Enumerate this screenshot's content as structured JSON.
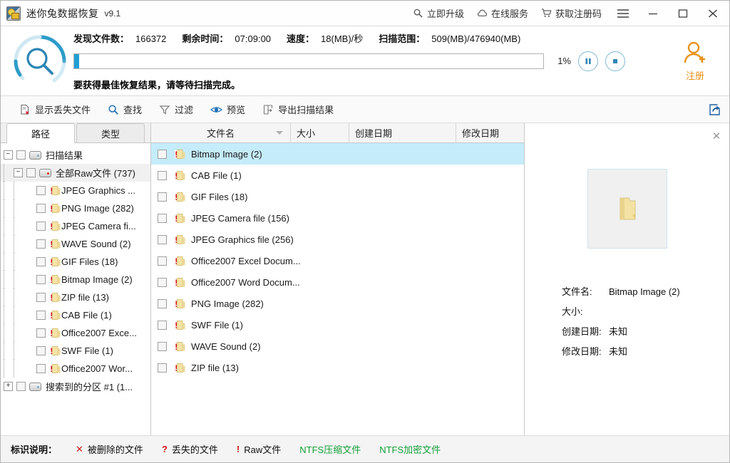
{
  "titlebar": {
    "app_icon": "app-logo-icon",
    "title": "迷你兔数据恢复",
    "version": "v9.1",
    "links": [
      {
        "icon": "magnifier-icon",
        "label": "立即升级"
      },
      {
        "icon": "cloud-icon",
        "label": "在线服务"
      },
      {
        "icon": "cart-icon",
        "label": "获取注册码"
      }
    ],
    "menu_icon": "hamburger-icon",
    "minimize_icon": "minimize-icon",
    "maximize_icon": "maximize-icon",
    "close_icon": "close-icon"
  },
  "scan": {
    "logo_icon": "scan-magnifier-icon",
    "stats": [
      {
        "label": "发现文件数：",
        "value": "166372"
      },
      {
        "label": "剩余时间：",
        "value": "07:09:00"
      },
      {
        "label": "速度：",
        "value": "18(MB)/秒"
      },
      {
        "label": "扫描范围：",
        "value": "509(MB)/476940(MB)"
      }
    ],
    "progress_percent": 1,
    "progress_label": "1%",
    "pause_icon": "pause-icon",
    "stop_icon": "stop-icon",
    "hint": "要获得最佳恢复结果，请等待扫描完成。",
    "register": {
      "icon": "user-add-icon",
      "label": "注册",
      "color": "#e8921b"
    }
  },
  "toolbar": {
    "buttons": [
      {
        "icon": "show-lost-files-icon",
        "label": "显示丢失文件"
      },
      {
        "icon": "search-icon",
        "label": "查找"
      },
      {
        "icon": "filter-icon",
        "label": "过滤"
      },
      {
        "icon": "preview-eye-icon",
        "label": "预览"
      },
      {
        "icon": "export-results-icon",
        "label": "导出扫描结果"
      }
    ],
    "share_icon": "share-export-icon"
  },
  "left_panel": {
    "tabs": [
      {
        "label": "路径",
        "active": true
      },
      {
        "label": "类型",
        "active": false
      }
    ],
    "tree": [
      {
        "label": "扫描结果",
        "depth": 0,
        "icon": "drive-icon",
        "expander": "minus",
        "selected": false
      },
      {
        "label": "全部Raw文件 (737)",
        "depth": 1,
        "icon": "drive-red-icon",
        "expander": "minus",
        "selected": true
      },
      {
        "label": "JPEG Graphics ...",
        "depth": 2,
        "icon": "raw-folder-icon",
        "expander": "none",
        "selected": false
      },
      {
        "label": "PNG Image (282)",
        "depth": 2,
        "icon": "raw-folder-icon",
        "expander": "none",
        "selected": false
      },
      {
        "label": "JPEG Camera fi...",
        "depth": 2,
        "icon": "raw-folder-icon",
        "expander": "none",
        "selected": false
      },
      {
        "label": "WAVE Sound (2)",
        "depth": 2,
        "icon": "raw-folder-icon",
        "expander": "none",
        "selected": false
      },
      {
        "label": "GIF Files (18)",
        "depth": 2,
        "icon": "raw-folder-icon",
        "expander": "none",
        "selected": false
      },
      {
        "label": "Bitmap Image (2)",
        "depth": 2,
        "icon": "raw-folder-icon",
        "expander": "none",
        "selected": false
      },
      {
        "label": "ZIP file (13)",
        "depth": 2,
        "icon": "raw-folder-icon",
        "expander": "none",
        "selected": false
      },
      {
        "label": "CAB File (1)",
        "depth": 2,
        "icon": "raw-folder-icon",
        "expander": "none",
        "selected": false
      },
      {
        "label": "Office2007 Exce...",
        "depth": 2,
        "icon": "raw-folder-icon",
        "expander": "none",
        "selected": false
      },
      {
        "label": "SWF File (1)",
        "depth": 2,
        "icon": "raw-folder-icon",
        "expander": "none",
        "selected": false
      },
      {
        "label": "Office2007 Wor...",
        "depth": 2,
        "icon": "raw-folder-icon",
        "expander": "none",
        "selected": false
      },
      {
        "label": "搜索到的分区 #1 (1...",
        "depth": 0,
        "icon": "drive-icon",
        "expander": "plus",
        "selected": false
      }
    ]
  },
  "file_list": {
    "columns": [
      {
        "label": "文件名",
        "sorted": true
      },
      {
        "label": "大小",
        "sorted": false
      },
      {
        "label": "创建日期",
        "sorted": false
      },
      {
        "label": "修改日期",
        "sorted": false
      }
    ],
    "rows": [
      {
        "name": "Bitmap Image (2)",
        "size": "",
        "created": "",
        "modified": "",
        "selected": true
      },
      {
        "name": "CAB File (1)",
        "size": "",
        "created": "",
        "modified": "",
        "selected": false
      },
      {
        "name": "GIF Files (18)",
        "size": "",
        "created": "",
        "modified": "",
        "selected": false
      },
      {
        "name": "JPEG Camera file (156)",
        "size": "",
        "created": "",
        "modified": "",
        "selected": false
      },
      {
        "name": "JPEG Graphics file (256)",
        "size": "",
        "created": "",
        "modified": "",
        "selected": false
      },
      {
        "name": "Office2007 Excel Docum...",
        "size": "",
        "created": "",
        "modified": "",
        "selected": false
      },
      {
        "name": "Office2007 Word Docum...",
        "size": "",
        "created": "",
        "modified": "",
        "selected": false
      },
      {
        "name": "PNG Image (282)",
        "size": "",
        "created": "",
        "modified": "",
        "selected": false
      },
      {
        "name": "SWF File (1)",
        "size": "",
        "created": "",
        "modified": "",
        "selected": false
      },
      {
        "name": "WAVE Sound (2)",
        "size": "",
        "created": "",
        "modified": "",
        "selected": false
      },
      {
        "name": "ZIP file (13)",
        "size": "",
        "created": "",
        "modified": "",
        "selected": false
      }
    ]
  },
  "preview": {
    "close_icon": "close-icon",
    "thumb_icon": "folder-icon",
    "fields": [
      {
        "key": "文件名:",
        "value": "Bitmap Image (2)"
      },
      {
        "key": "大小:",
        "value": ""
      },
      {
        "key": "创建日期:",
        "value": "未知"
      },
      {
        "key": "修改日期:",
        "value": "未知"
      }
    ]
  },
  "legend": {
    "title": "标识说明：",
    "items": [
      {
        "mark": "✕",
        "label": "被删除的文件",
        "mark_color": "#d01a1a",
        "text_color": "#111111"
      },
      {
        "mark": "?",
        "label": "丢失的文件",
        "mark_color": "#d01a1a",
        "text_color": "#111111"
      },
      {
        "mark": "!",
        "label": "Raw文件",
        "mark_color": "#d01a1a",
        "text_color": "#111111"
      },
      {
        "mark": "",
        "label": "NTFS压缩文件",
        "mark_color": "#17a13a",
        "text_color": "#17a13a"
      },
      {
        "mark": "",
        "label": "NTFS加密文件",
        "mark_color": "#17a13a",
        "text_color": "#17a13a"
      }
    ]
  }
}
